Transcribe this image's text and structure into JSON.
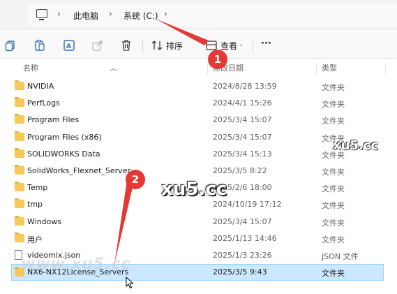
{
  "breadcrumb": {
    "items": [
      "此电脑",
      "系统 (C:)"
    ],
    "sep": "›"
  },
  "toolbar": {
    "sort_label": "排序",
    "view_label": "查看",
    "more_label": "···"
  },
  "columns": {
    "name": "名称",
    "date": "修改日期",
    "type": "类型"
  },
  "files": [
    {
      "name": "NVIDIA",
      "date": "2024/8/28 13:59",
      "type": "文件夹",
      "kind": "folder"
    },
    {
      "name": "PerfLogs",
      "date": "2024/4/1 15:26",
      "type": "文件夹",
      "kind": "folder"
    },
    {
      "name": "Program Files",
      "date": "2025/3/4 15:07",
      "type": "文件夹",
      "kind": "folder"
    },
    {
      "name": "Program Files (x86)",
      "date": "2025/3/4 15:07",
      "type": "文件夹",
      "kind": "folder"
    },
    {
      "name": "SOLIDWORKS Data",
      "date": "2025/3/4 15:13",
      "type": "文件夹",
      "kind": "folder"
    },
    {
      "name": "SolidWorks_Flexnet_Server",
      "date": "2025/3/5 8:22",
      "type": "文件夹",
      "kind": "folder"
    },
    {
      "name": "Temp",
      "date": "2025/2/6 18:00",
      "type": "文件夹",
      "kind": "folder"
    },
    {
      "name": "tmp",
      "date": "2024/10/19 17:12",
      "type": "文件夹",
      "kind": "folder"
    },
    {
      "name": "Windows",
      "date": "2025/3/4 15:07",
      "type": "文件夹",
      "kind": "folder"
    },
    {
      "name": "用户",
      "date": "2025/1/13 14:46",
      "type": "文件夹",
      "kind": "folder"
    },
    {
      "name": "videomix.json",
      "date": "2025/1/3 23:26",
      "type": "JSON 文件",
      "kind": "file"
    },
    {
      "name": "NX6-NX12License_Servers",
      "date": "2025/3/5 9:43",
      "type": "文件夹",
      "kind": "folder",
      "selected": true
    }
  ],
  "annotations": {
    "badge1": "1",
    "badge2": "2",
    "watermark_small": "xu5.cc",
    "watermark_large": "xu5.cc",
    "watermark_faint": "www.xu5.cc"
  },
  "colors": {
    "selection_bg": "#cce8ff",
    "selection_border": "#99d1ff",
    "folder": "#f8c95a",
    "arrow_red": "#e53935"
  }
}
